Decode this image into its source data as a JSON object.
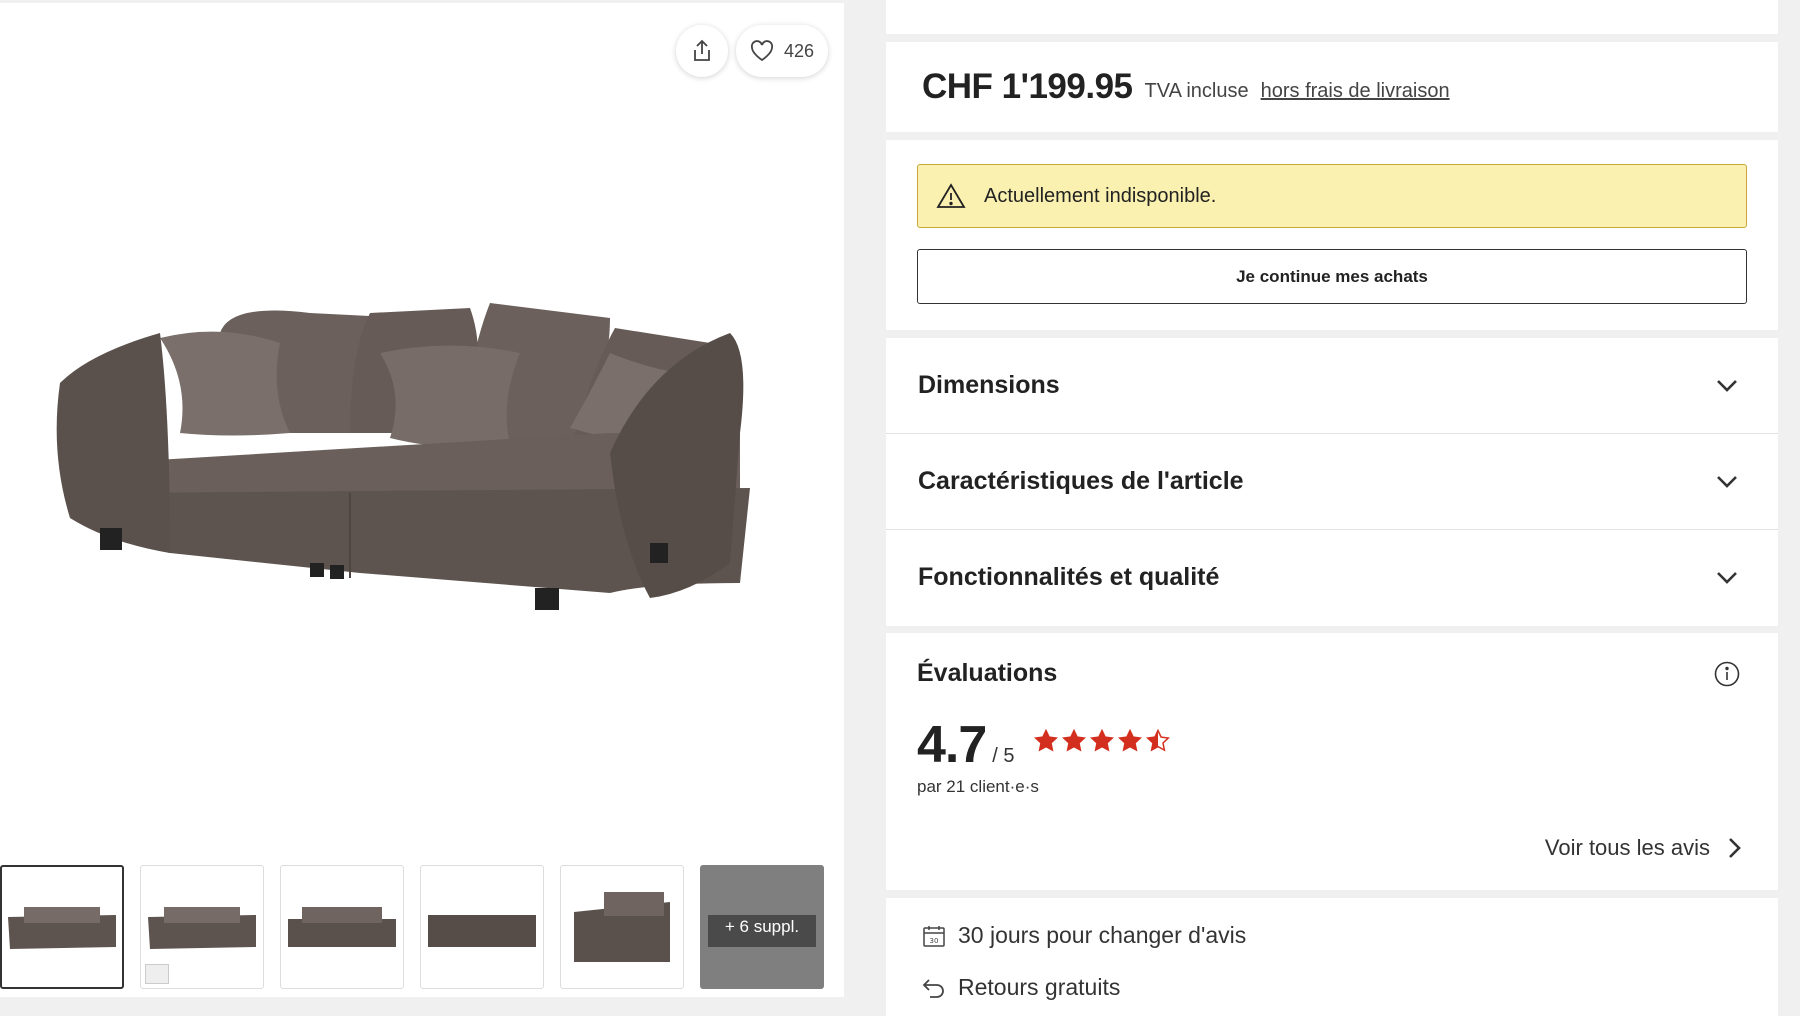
{
  "gallery": {
    "wishlist_count": "426",
    "more_label": "+ 6 suppl."
  },
  "price": {
    "amount": "CHF 1'199.95",
    "tax_note": "TVA incluse",
    "delivery_link": "hors frais de livraison"
  },
  "availability": {
    "alert_text": "Actuellement indisponible.",
    "continue_label": "Je continue mes achats"
  },
  "accordion": {
    "items": [
      {
        "label": "Dimensions"
      },
      {
        "label": "Caractéristiques de l'article"
      },
      {
        "label": "Fonctionnalités et qualité"
      }
    ]
  },
  "reviews": {
    "title": "Évaluations",
    "score": "4.7",
    "out_of": "/ 5",
    "rating": 4.7,
    "count_text": "par 21 client·e·s",
    "all_link": "Voir tous les avis",
    "star_color": "#d32f1e"
  },
  "perks": {
    "items": [
      {
        "icon": "calendar-icon",
        "label": "30 jours pour changer d'avis"
      },
      {
        "icon": "return-arrow-icon",
        "label": "Retours gratuits"
      }
    ]
  }
}
